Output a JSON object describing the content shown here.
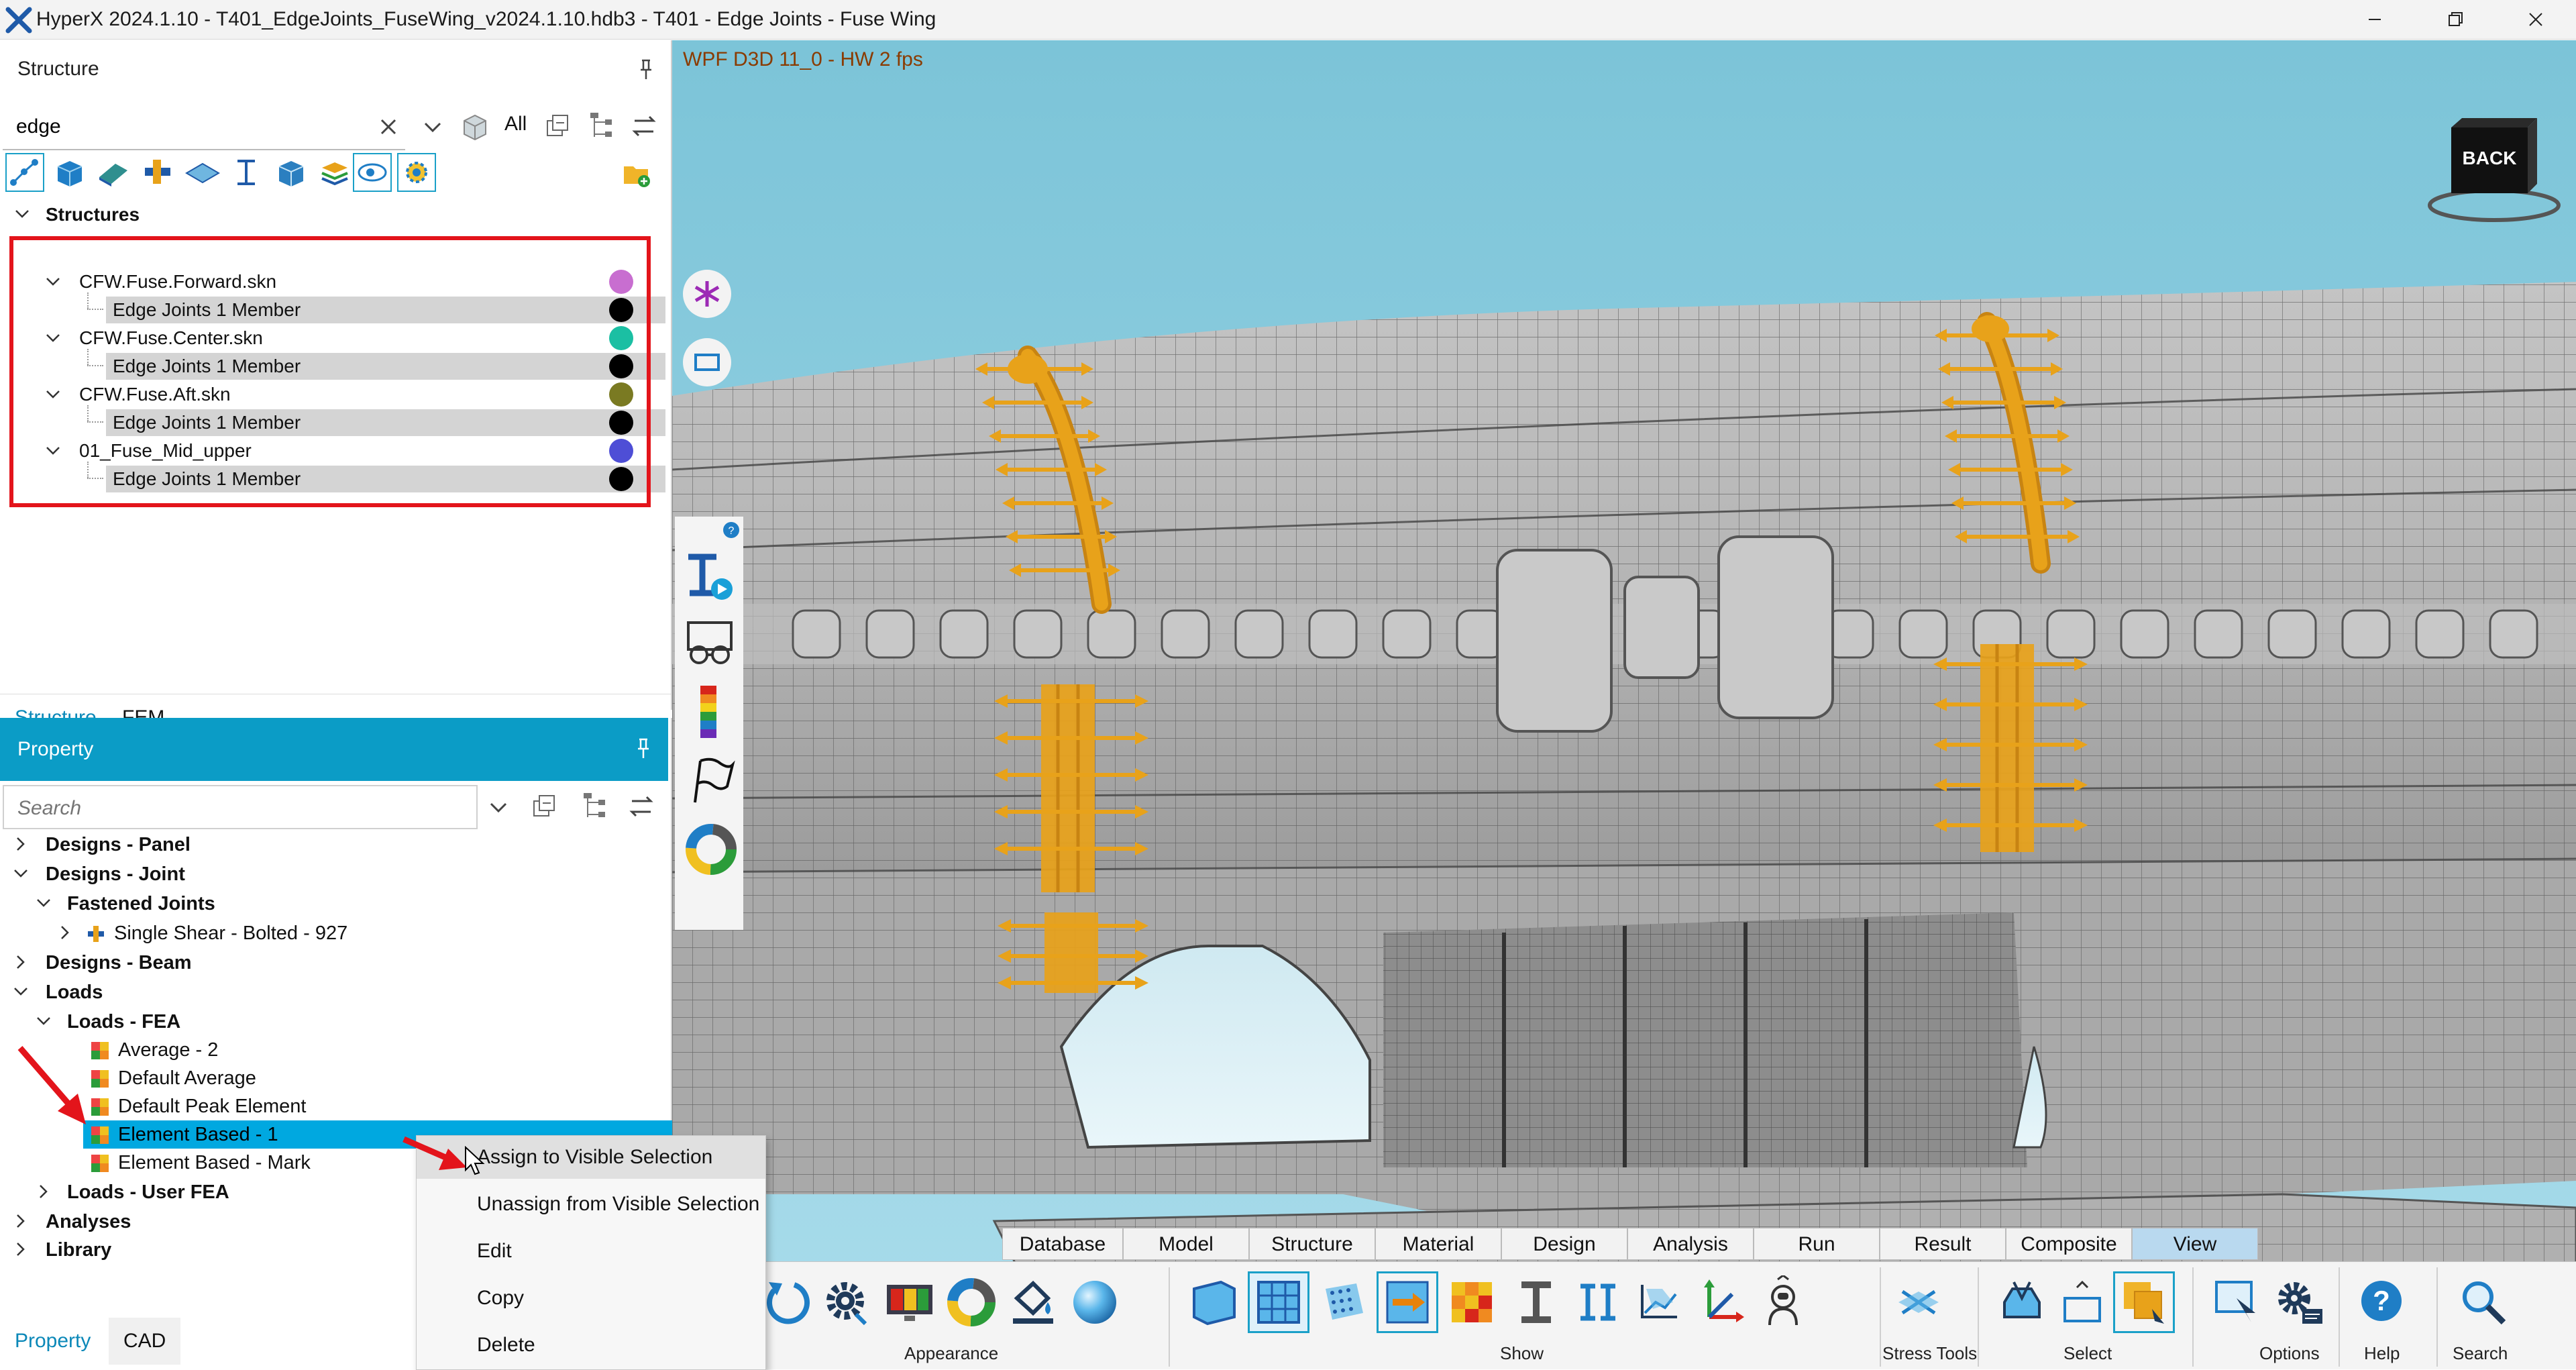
{
  "window": {
    "title": "HyperX 2024.1.10 - T401_EdgeJoints_FuseWing_v2024.1.10.hdb3 - T401 - Edge Joints - Fuse Wing"
  },
  "structure_panel": {
    "title": "Structure",
    "search_value": "edge",
    "filter_all_label": "All",
    "tree": {
      "root": "Structures",
      "groups": [
        {
          "name": "CFW.Fuse.Forward.skn",
          "color": "#c86ed0",
          "member": "Edge Joints 1 Member"
        },
        {
          "name": "CFW.Fuse.Center.skn",
          "color": "#1bbfa3",
          "member": "Edge Joints 1 Member"
        },
        {
          "name": "CFW.Fuse.Aft.skn",
          "color": "#7a7a22",
          "member": "Edge Joints 1 Member"
        },
        {
          "name": "01_Fuse_Mid_upper",
          "color": "#4e4ed6",
          "member": "Edge Joints 1 Member"
        }
      ]
    },
    "tabs": [
      "Structure",
      "FEM"
    ]
  },
  "property_panel": {
    "title": "Property",
    "search_placeholder": "Search",
    "items": [
      {
        "label": "Designs - Panel"
      },
      {
        "label": "Designs - Joint"
      },
      {
        "label": "Fastened Joints"
      },
      {
        "label": "Single Shear - Bolted - 927"
      },
      {
        "label": "Designs - Beam"
      },
      {
        "label": "Loads"
      },
      {
        "label": "Loads - FEA"
      },
      {
        "label": "Average - 2"
      },
      {
        "label": "Default Average"
      },
      {
        "label": "Default Peak Element"
      },
      {
        "label": "Element Based - 1"
      },
      {
        "label": "Element Based - Mark"
      },
      {
        "label": "Loads - User FEA"
      },
      {
        "label": "Analyses"
      },
      {
        "label": "Library"
      }
    ],
    "tabs": [
      "Property",
      "CAD"
    ]
  },
  "viewport": {
    "label": "WPF D3D 11_0  - HW  2 fps",
    "back_label": "BACK"
  },
  "context_menu": {
    "items": [
      "Assign to Visible Selection",
      "Unassign from Visible Selection",
      "Edit",
      "Copy",
      "Delete"
    ]
  },
  "ribbon": {
    "tabs": [
      "Database",
      "Model",
      "Structure",
      "Material",
      "Design",
      "Analysis",
      "Run",
      "Result",
      "Composite",
      "View"
    ],
    "active_tab": "View",
    "groups": [
      "Appearance",
      "Show",
      "Stress Tools",
      "Select",
      "Options",
      "Help",
      "Search"
    ]
  },
  "colors": {
    "accent": "#0b9cc6",
    "highlight": "#00a8e0",
    "annotation_red": "#e3141b",
    "joint_orange": "#e8a21a"
  }
}
